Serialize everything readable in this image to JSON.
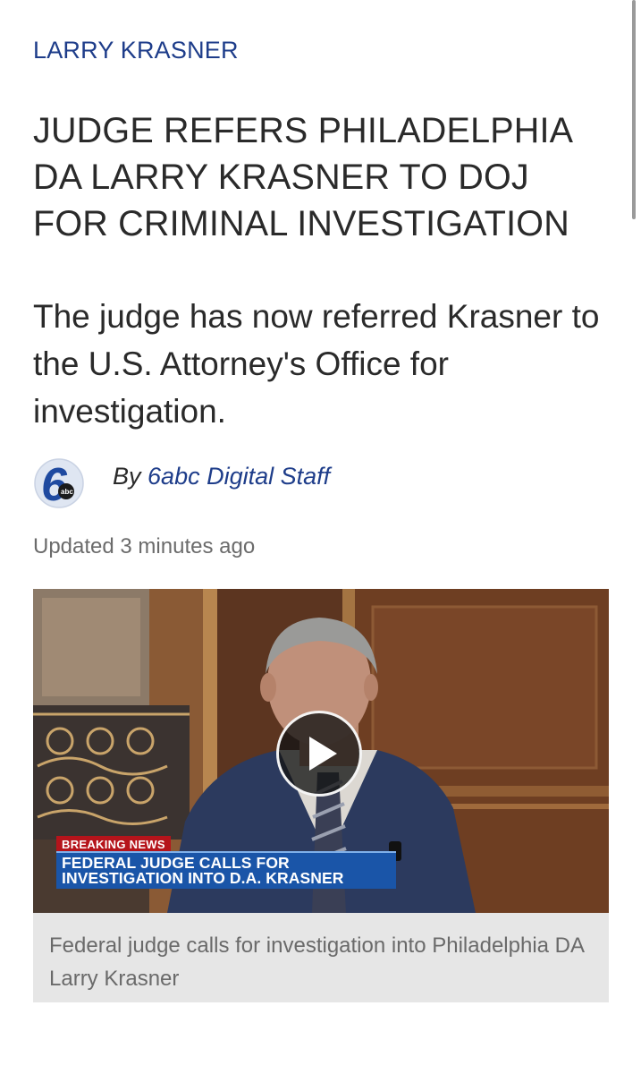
{
  "article": {
    "kicker": "LARRY KRASNER",
    "headline": "JUDGE REFERS PHILADELPHIA DA LARRY KRASNER TO DOJ FOR CRIMINAL INVESTIGATION",
    "dek": "The judge has now referred Krasner to the U.S. Attorney's Office for investigation.",
    "byline": {
      "prefix": "By",
      "author": "6abc Digital Staff",
      "logo_icon": "6abc-logo-icon",
      "logo_text": "abc"
    },
    "updated": "Updated 3 minutes ago"
  },
  "video": {
    "play_icon": "play-icon",
    "breaking_label": "BREAKING NEWS",
    "lower_third_line1": "FEDERAL JUDGE CALLS FOR",
    "lower_third_line2": "INVESTIGATION INTO D.A. KRASNER",
    "caption": "Federal judge calls for investigation into Philadelphia DA Larry Krasner"
  },
  "colors": {
    "link_blue": "#1e3d8a",
    "breaking_red": "#b5141b",
    "lower_third_blue": "#1a55a8",
    "caption_bg": "#e6e6e6"
  }
}
